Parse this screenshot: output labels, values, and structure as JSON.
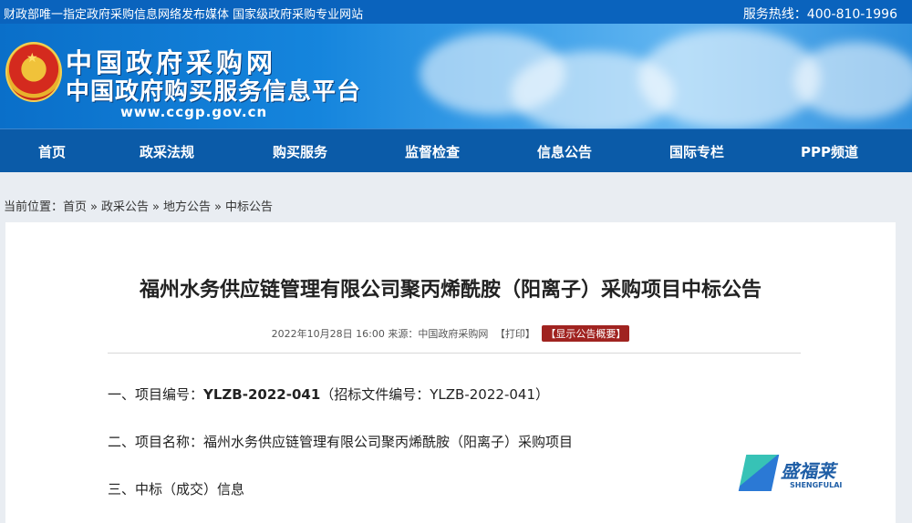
{
  "topbar": {
    "left": "财政部唯一指定政府采购信息网络发布媒体 国家级政府采购专业网站",
    "hotline": "服务热线：400-810-1996"
  },
  "banner": {
    "name": "中国政府采购网",
    "subtitle": "中国政府购买服务信息平台",
    "url": "www.ccgp.gov.cn",
    "emblem_icon": "national-emblem-icon"
  },
  "nav": {
    "items": [
      "首页",
      "政采法规",
      "购买服务",
      "监督检查",
      "信息公告",
      "国际专栏",
      "PPP频道"
    ]
  },
  "breadcrumb": {
    "label": "当前位置：",
    "items": [
      "首页",
      "政采公告",
      "地方公告",
      "中标公告"
    ]
  },
  "article": {
    "title": "福州水务供应链管理有限公司聚丙烯酰胺（阳离子）采购项目中标公告",
    "meta_date_source": "2022年10月28日 16:00 来源：中国政府采购网",
    "print": "【打印】",
    "summary_button": "【显示公告概要】",
    "lines": [
      {
        "prefix": "一、项目编号：",
        "strong": "YLZB-2022-041",
        "rest": "（招标文件编号：YLZB-2022-041）"
      },
      {
        "prefix": "二、项目名称：",
        "strong": "",
        "rest": "福州水务供应链管理有限公司聚丙烯酰胺（阳离子）采购项目"
      },
      {
        "prefix": "三、中标（成交）信息",
        "strong": "",
        "rest": ""
      }
    ]
  },
  "watermark": {
    "name": "盛福莱",
    "en": "SHENGFULAI"
  },
  "colors": {
    "topbar": "#0a63bd",
    "nav": "#0b5ba8",
    "summary_badge": "#a02320"
  }
}
